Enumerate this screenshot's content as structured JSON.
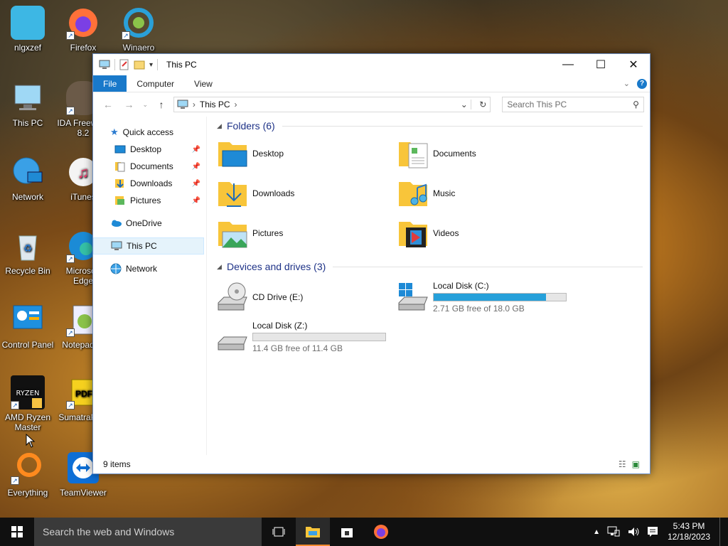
{
  "desktop": {
    "icons_left": [
      {
        "label": "nlgxzef"
      },
      {
        "label": "This PC"
      },
      {
        "label": "Network"
      },
      {
        "label": "Recycle Bin"
      },
      {
        "label": "Control Panel"
      },
      {
        "label": "AMD Ryzen Master"
      },
      {
        "label": "Everything"
      }
    ],
    "icons_right": [
      {
        "label": "Firefox"
      },
      {
        "label": "IDA Freeware 8.2"
      },
      {
        "label": "iTunes"
      },
      {
        "label": "Microsoft Edge"
      },
      {
        "label": "Notepad++"
      },
      {
        "label": "SumatraPDF"
      },
      {
        "label": "TeamViewer"
      }
    ],
    "icon_winaero": {
      "label": "Winaero"
    }
  },
  "window": {
    "title": "This PC",
    "ribbon_tabs": [
      "File",
      "Computer",
      "View"
    ],
    "address": {
      "location": "This PC"
    },
    "search": {
      "placeholder": "Search This PC"
    },
    "sidebar": {
      "quick_access": "Quick access",
      "pinned": [
        {
          "label": "Desktop"
        },
        {
          "label": "Documents"
        },
        {
          "label": "Downloads"
        },
        {
          "label": "Pictures"
        }
      ],
      "onedrive": "OneDrive",
      "this_pc": "This PC",
      "network": "Network"
    },
    "folders_group": "Folders (6)",
    "folders": [
      {
        "label": "Desktop"
      },
      {
        "label": "Documents"
      },
      {
        "label": "Downloads"
      },
      {
        "label": "Music"
      },
      {
        "label": "Pictures"
      },
      {
        "label": "Videos"
      }
    ],
    "drives_group": "Devices and drives (3)",
    "drives": {
      "cd": {
        "label": "CD Drive (E:)"
      },
      "c": {
        "label": "Local Disk (C:)",
        "free": "2.71 GB free of 18.0 GB",
        "used_fraction": 0.85
      },
      "z": {
        "label": "Local Disk (Z:)",
        "free": "11.4 GB free of 11.4 GB",
        "used_fraction": 0.0
      }
    },
    "status": "9 items"
  },
  "taskbar": {
    "search_text": "Search the web and Windows",
    "time": "5:43 PM",
    "date": "12/18/2023"
  },
  "colors": {
    "accent": "#1979ca",
    "drive_fill": "#26a0da",
    "folder_yellow": "#f8c53a"
  }
}
